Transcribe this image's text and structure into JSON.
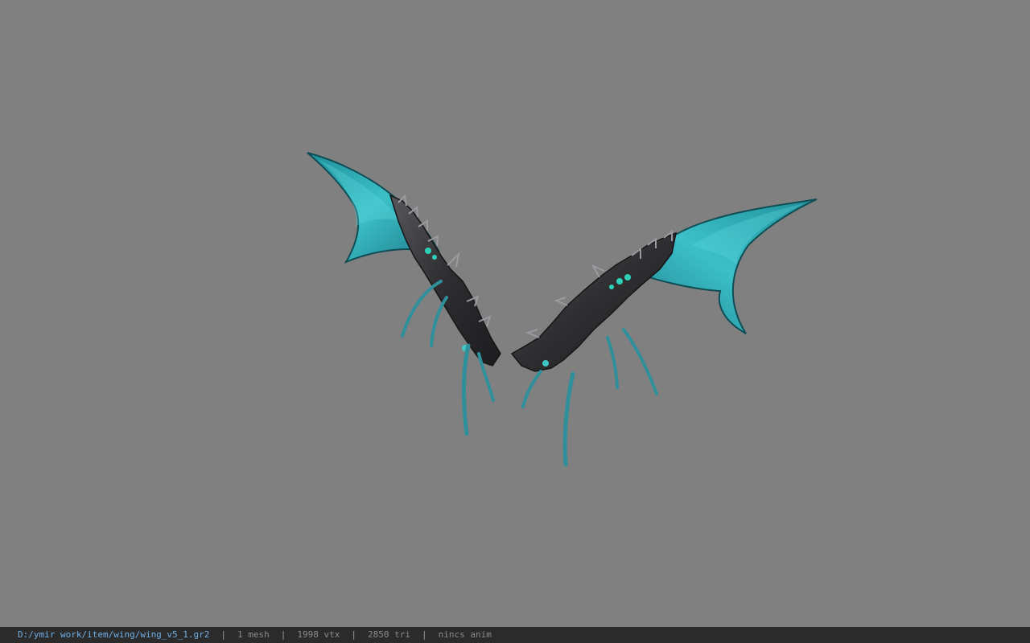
{
  "viewer": {
    "background_color": "#808080",
    "model": {
      "icon": "wing-model",
      "membrane_color": "#2fb3bf",
      "membrane_highlight": "#5fd6dc",
      "bone_color": "#3c3c3e",
      "bone_highlight": "#9a9aa0",
      "tendril_color": "#2f8f9a"
    }
  },
  "status_bar": {
    "file_path": "D:/ymir work/item/wing/wing_v5_1.gr2",
    "separator": "|",
    "mesh_count": "1 mesh",
    "vertex_count": "1998 vtx",
    "triangle_count": "2850 tri",
    "anim_status": "nincs anim"
  }
}
